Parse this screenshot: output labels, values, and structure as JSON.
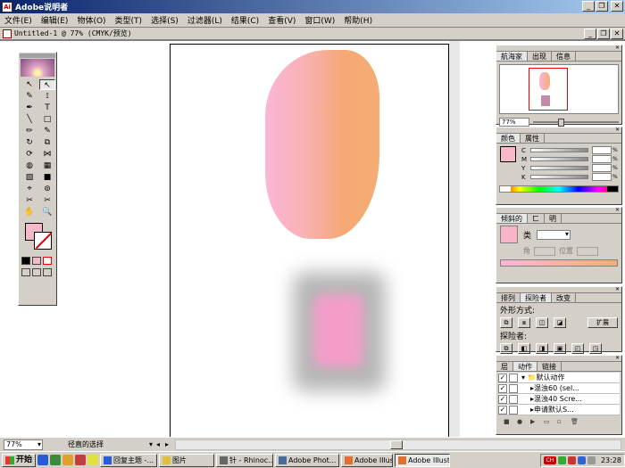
{
  "app": {
    "title": "Adobe说明者",
    "icon": "illustrator-app-icon"
  },
  "menu": [
    "文件(E)",
    "编辑(E)",
    "物体(O)",
    "类型(T)",
    "选择(S)",
    "过滤器(L)",
    "结果(C)",
    "查看(V)",
    "窗口(W)",
    "帮助(H)"
  ],
  "document": {
    "title": "Untitled-1 @ 77% (CMYK/预览)"
  },
  "toolbox": {
    "tools": [
      "↖",
      "↖",
      "✎",
      "⟟",
      "✒",
      "T",
      "╲",
      "□",
      "✏",
      "✎",
      "↻",
      "⧉",
      "⟳",
      "⋈",
      "◍",
      "▦",
      "▧",
      "■",
      "⌖",
      "⊚",
      "✂",
      "✂",
      "✋",
      "🔍"
    ]
  },
  "navigator": {
    "tabs": [
      "航海家",
      "出现",
      "信息"
    ],
    "zoom": "77%"
  },
  "color": {
    "tabs": [
      "颜色",
      "属性"
    ],
    "channels": [
      "C",
      "M",
      "Y",
      "K"
    ],
    "unit": "%"
  },
  "gradient": {
    "tabs": [
      "倾斜的",
      "ㄈ",
      "明"
    ],
    "type_label": "类",
    "angle_label": "角",
    "position_label": "位置"
  },
  "pathfinder": {
    "tabs": [
      "排列",
      "探险者",
      "改变"
    ],
    "shape_modes_label": "外形方式:",
    "pathfinders_label": "探险者:",
    "expand_label": "扩展"
  },
  "actions": {
    "tabs": [
      "层",
      "动作",
      "链接"
    ],
    "set_name": "默认动作",
    "items": [
      "混浊60 (sel...",
      "混浊40 Scre...",
      "申请默认S..."
    ]
  },
  "status": {
    "zoom": "77%",
    "info": "径直的选择"
  },
  "taskbar": {
    "start": "开始",
    "tasks": [
      "回复主题 -...",
      "图片",
      "针 - Rhinoc...",
      "Adobe Phot...",
      "Adobe Illust...",
      "Adobe Illust..."
    ],
    "clock": "23:28",
    "ime": "CH"
  },
  "colors": {
    "accent_fill": "#f8b8c8",
    "titlebar": "#0a246a"
  }
}
